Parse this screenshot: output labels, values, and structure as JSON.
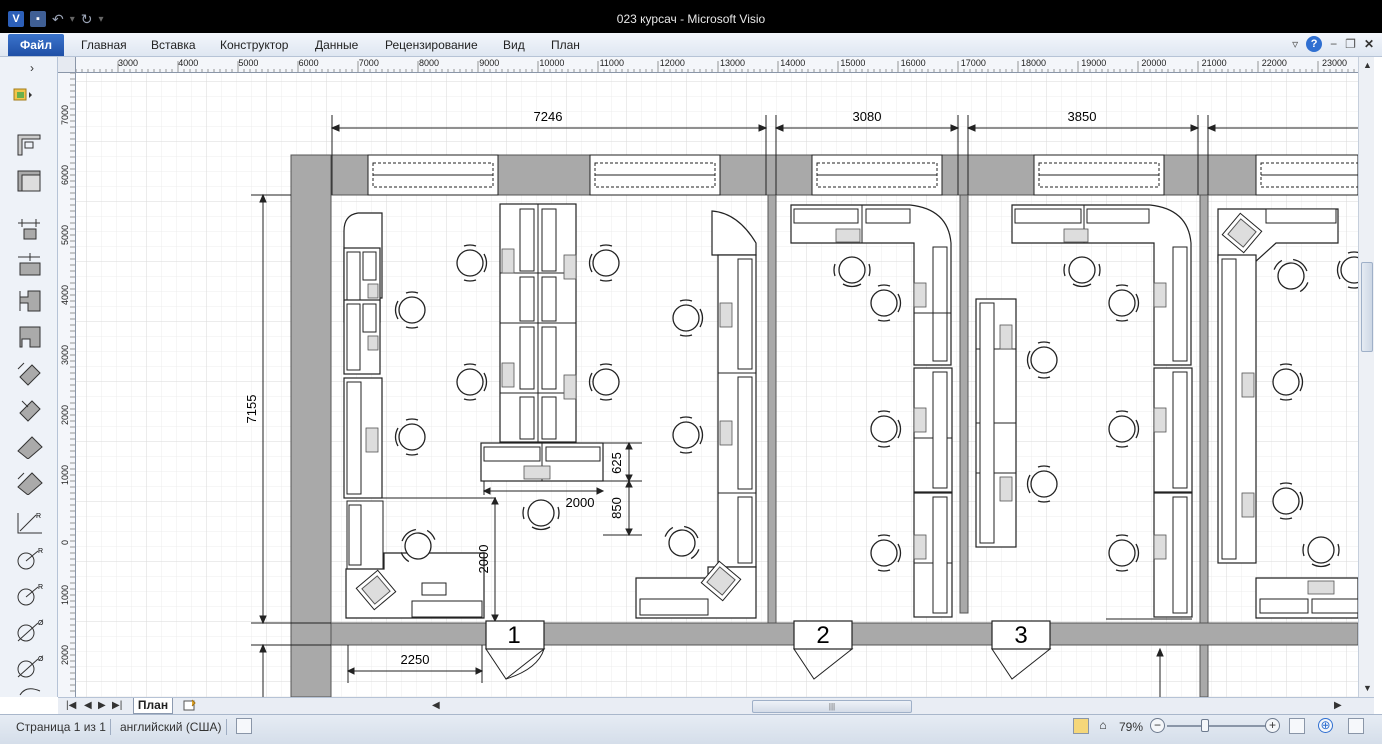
{
  "window": {
    "title": "023 курсач  -  Microsoft Visio"
  },
  "ribbon": {
    "file_tab": "Файл",
    "tabs": [
      "Главная",
      "Вставка",
      "Конструктор",
      "Данные",
      "Рецензирование",
      "Вид",
      "План"
    ]
  },
  "ruler": {
    "h_labels": [
      "3000",
      "4000",
      "5000",
      "6000",
      "7000",
      "8000",
      "9000",
      "10000",
      "11000",
      "12000",
      "13000",
      "14000",
      "15000",
      "16000",
      "17000",
      "18000",
      "19000",
      "20000",
      "21000",
      "22000",
      "23000"
    ],
    "v_labels": [
      "7000",
      "6000",
      "5000",
      "4000",
      "3000",
      "2000",
      "1000",
      "0",
      "1000",
      "2000"
    ]
  },
  "plan": {
    "dims": {
      "top_room1": "7246",
      "top_room2": "3080",
      "top_room3": "3850",
      "left_height": "7155",
      "desk_depth": "625",
      "aisle": "850",
      "aisle_width": "2000",
      "door_offset": "2000",
      "bottom_width": "2250"
    },
    "room_numbers": [
      "1",
      "2",
      "3"
    ]
  },
  "pagebar": {
    "page_tab": "План"
  },
  "statusbar": {
    "page_info": "Страница 1 из 1",
    "language": "английский (США)",
    "zoom": "79%"
  },
  "colors": {
    "wall": "#a9a9a9",
    "file_tab": "#2a5db5",
    "grid": "#e6e6e6"
  }
}
